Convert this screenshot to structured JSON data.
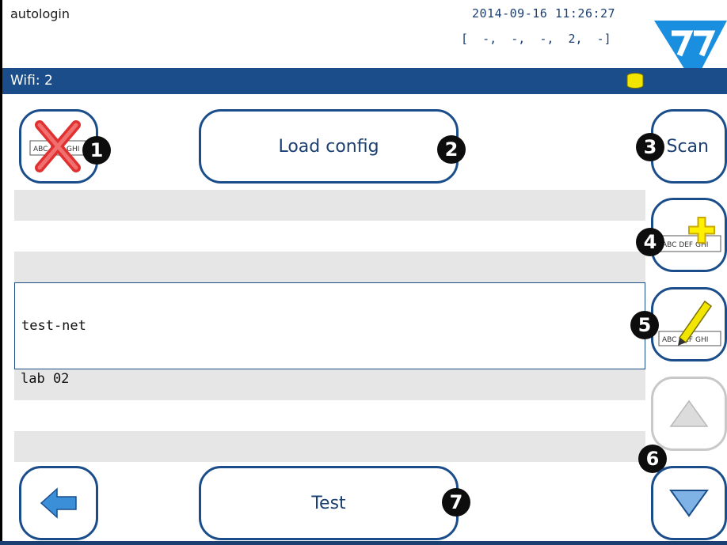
{
  "header": {
    "user": "autologin",
    "datetime": "2014-09-16 11:26:27",
    "status_line": "[  -,  -,  -,  2,  -]",
    "wifi_label": "Wifi: 2",
    "db_icon": "database-icon",
    "logo": "brand-logo"
  },
  "toolbar": {
    "delete_icon": "delete-entry-icon",
    "load_config_label": "Load config",
    "scan_label": "Scan"
  },
  "side": {
    "add_icon": "add-entry-icon",
    "edit_icon": "edit-entry-icon",
    "up_icon": "arrow-up-icon",
    "down_icon": "arrow-down-icon"
  },
  "list": {
    "rows": [
      "",
      "",
      "",
      "test-net",
      "lab 02",
      "",
      ""
    ],
    "selected_index": 3
  },
  "footer": {
    "back_icon": "back-arrow-icon",
    "test_label": "Test"
  },
  "callouts": [
    "1",
    "2",
    "3",
    "4",
    "5",
    "6",
    "7"
  ],
  "colors": {
    "accent": "#1a4d8a",
    "logo": "#1a8fe0",
    "badge": "#0d0d0d"
  }
}
